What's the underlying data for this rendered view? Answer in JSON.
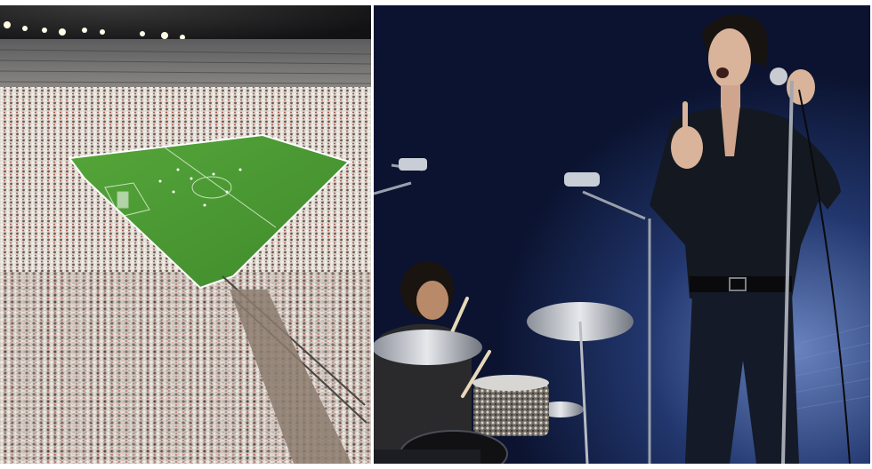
{
  "images": [
    {
      "id": "stadium",
      "caption": ""
    },
    {
      "id": "concert",
      "caption": ""
    }
  ],
  "colors": {
    "divider": "#ffffff",
    "pitch": "#3f8a2c",
    "pitch_light": "#56a63a",
    "stage_background": "#0b1330",
    "crowd": "#e6e2dc"
  }
}
